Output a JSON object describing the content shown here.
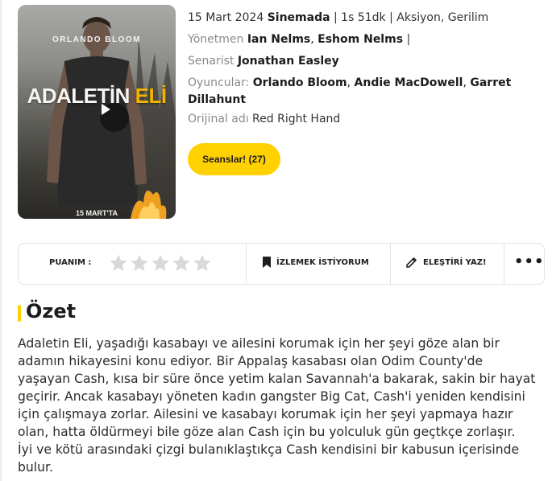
{
  "poster": {
    "actor_text": "ORLANDO BLOOM",
    "title_main": "ADALETİN",
    "title_accent": "ELİ",
    "date_text": "15 MART'TA"
  },
  "info": {
    "release_date": "15 Mart 2024",
    "release_status": "Sinemada",
    "details": "| 1s 51dk | Aksiyon, Gerilim",
    "director_label": "Yönetmen",
    "directors": [
      "Ian Nelms",
      "Eshom Nelms"
    ],
    "director_suffix": "|",
    "writer_label": "Senarist",
    "writer": "Jonathan Easley",
    "cast_label": "Oyuncular:",
    "cast": [
      "Orlando Bloom",
      "Andie MacDowell",
      "Garret",
      "Dillahunt"
    ],
    "original_title_label": "Orijinal adı",
    "original_title": "Red Right Hand",
    "sessions_button": "Seanslar! (27)"
  },
  "actions": {
    "rating_label": "PUANIM :",
    "rating_value": 0,
    "rating_max": 5,
    "watchlist": "İZLEMEK İSTİYORUM",
    "review": "ELEŞTİRİ YAZ!",
    "more_icon": "more-dots-icon"
  },
  "summary": {
    "title": "Özet",
    "lines": [
      "Adaletin Eli, yaşadığı kasabayı ve ailesini korumak için her şeyi göze alan bir",
      "adamın hikayesini konu ediyor. Bir Appalaş kasabası olan Odim County'de",
      "yaşayan Cash, kısa bir süre önce yetim kalan Savannah'a bakarak, sakin bir hayat",
      "geçirir. Ancak kasabayı yöneten kadın gangster Big Cat, Cash'i yeniden kendisini",
      "için çalışmaya zorlar. Ailesini ve kasabayı korumak için her şeyi yapmaya hazır",
      "olan, hatta öldürmeyi bile göze alan Cash için bu yolculuk gün geçtkçe zorlaşır.",
      "İyi ve kötü arasındaki çizgi bulanıklaştıkça Cash kendisini bir kabusun içerisinde",
      "bulur."
    ]
  },
  "colors": {
    "accent": "#ffd100",
    "star_empty": "#d9d9d9",
    "muted_text": "#8a8a8a"
  }
}
